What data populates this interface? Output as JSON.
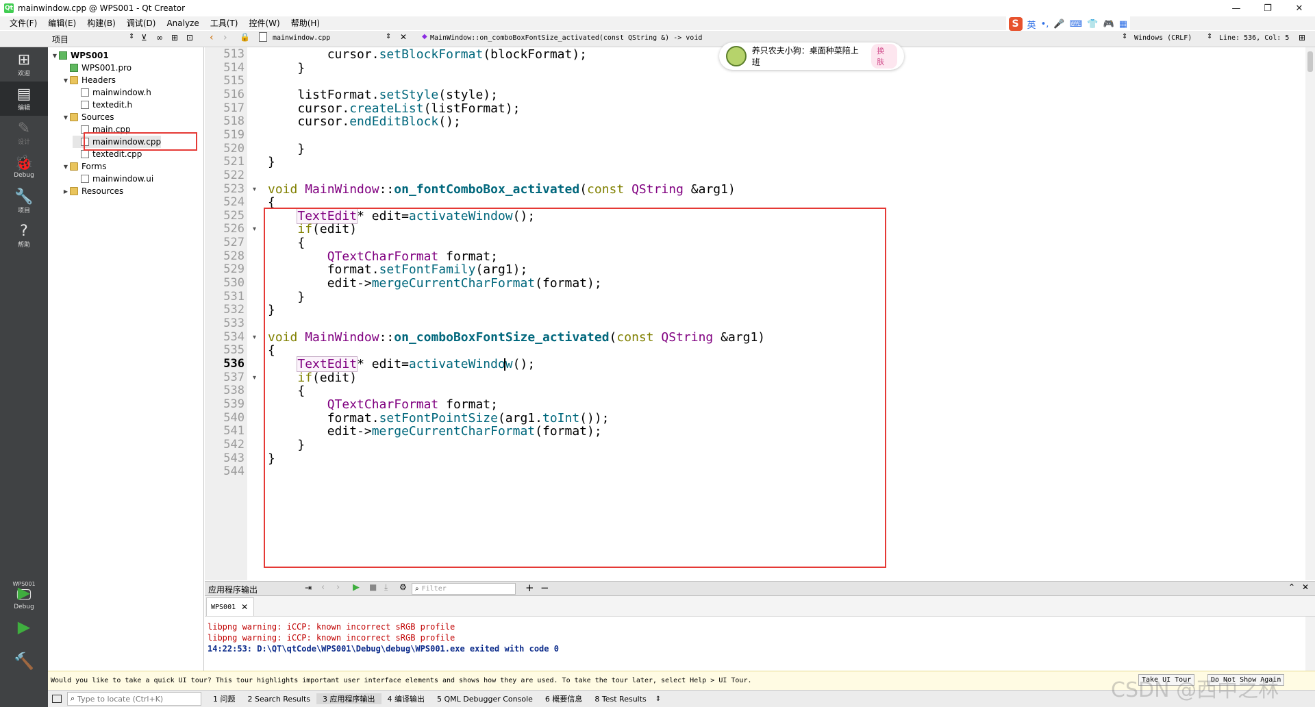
{
  "window": {
    "title": "mainwindow.cpp @ WPS001 - Qt Creator",
    "app_icon_text": "Qt",
    "minimize_icon": "—",
    "maximize_icon": "❐",
    "close_icon": "✕"
  },
  "menu": [
    "文件(F)",
    "编辑(E)",
    "构建(B)",
    "调试(D)",
    "Analyze",
    "工具(T)",
    "控件(W)",
    "帮助(H)"
  ],
  "ime": {
    "logo": "S",
    "lang": "英",
    "punct": "•,",
    "mic": "🎤",
    "keyboard": "⌨",
    "skin": "👕",
    "game": "🎮",
    "apps": "▦"
  },
  "toolbar": {
    "project_label": "项目",
    "file_tab": "mainwindow.cpp",
    "function_crumb": "MainWindow::on_comboBoxFontSize_activated(const QString &) -> void",
    "line_ending": "Windows (CRLF)",
    "cursor_pos": "Line: 536, Col: 5"
  },
  "modes": [
    {
      "label": "欢迎",
      "icon": "⊞"
    },
    {
      "label": "编辑",
      "icon": "▤"
    },
    {
      "label": "设计",
      "icon": "✎"
    },
    {
      "label": "Debug",
      "icon": "🐞"
    },
    {
      "label": "项目",
      "icon": "🔧"
    },
    {
      "label": "帮助",
      "icon": "?"
    }
  ],
  "kit": {
    "name": "WPS001",
    "mode": "Debug",
    "run_icon": "▶",
    "debug_run_icon": "▶",
    "build_icon": "🔨"
  },
  "tree": [
    {
      "label": "WPS001",
      "arrow": "▼",
      "kind": "pro",
      "indent": 0,
      "bold": true
    },
    {
      "label": "WPS001.pro",
      "arrow": "",
      "kind": "pro",
      "indent": 1
    },
    {
      "label": "Headers",
      "arrow": "▼",
      "kind": "folder",
      "indent": 1
    },
    {
      "label": "mainwindow.h",
      "arrow": "",
      "kind": "file",
      "indent": 2
    },
    {
      "label": "textedit.h",
      "arrow": "",
      "kind": "file",
      "indent": 2
    },
    {
      "label": "Sources",
      "arrow": "▼",
      "kind": "folder",
      "indent": 1
    },
    {
      "label": "main.cpp",
      "arrow": "",
      "kind": "file",
      "indent": 2
    },
    {
      "label": "mainwindow.cpp",
      "arrow": "",
      "kind": "file",
      "indent": 2
    },
    {
      "label": "textedit.cpp",
      "arrow": "",
      "kind": "file",
      "indent": 2
    },
    {
      "label": "Forms",
      "arrow": "▼",
      "kind": "folder",
      "indent": 1
    },
    {
      "label": "mainwindow.ui",
      "arrow": "",
      "kind": "file",
      "indent": 2
    },
    {
      "label": "Resources",
      "arrow": "▶",
      "kind": "folder",
      "indent": 1
    }
  ],
  "code": {
    "first_line": 513,
    "current_line": 536,
    "fold_lines": [
      523,
      526,
      534,
      537
    ],
    "lines": [
      [
        [
          "        cursor.",
          "v"
        ],
        [
          "setBlockFormat",
          "f"
        ],
        [
          "(blockFormat);",
          "v"
        ]
      ],
      [
        [
          "    }",
          "v"
        ]
      ],
      [
        [
          "",
          "v"
        ]
      ],
      [
        [
          "    listFormat.",
          "v"
        ],
        [
          "setStyle",
          "f"
        ],
        [
          "(style);",
          "v"
        ]
      ],
      [
        [
          "    cursor.",
          "v"
        ],
        [
          "createList",
          "f"
        ],
        [
          "(listFormat);",
          "v"
        ]
      ],
      [
        [
          "    cursor.",
          "v"
        ],
        [
          "endEditBlock",
          "f"
        ],
        [
          "();",
          "v"
        ]
      ],
      [
        [
          "",
          "v"
        ]
      ],
      [
        [
          "    }",
          "v"
        ]
      ],
      [
        [
          "}",
          "v"
        ]
      ],
      [
        [
          "",
          "v"
        ]
      ],
      [
        [
          "void",
          "k"
        ],
        [
          " MainWindow",
          "t"
        ],
        [
          "::",
          "v"
        ],
        [
          "on_fontComboBox_activated",
          "fb"
        ],
        [
          "(",
          "v"
        ],
        [
          "const",
          "k"
        ],
        [
          " QString",
          "t"
        ],
        [
          " &arg1)",
          "v"
        ]
      ],
      [
        [
          "{",
          "v"
        ]
      ],
      [
        [
          "    ",
          "v"
        ],
        [
          "TextEdit",
          "t hl"
        ],
        [
          "* edit=",
          "v"
        ],
        [
          "activateWindow",
          "f"
        ],
        [
          "();",
          "v"
        ]
      ],
      [
        [
          "    ",
          "v"
        ],
        [
          "if",
          "k"
        ],
        [
          "(edit)",
          "v"
        ]
      ],
      [
        [
          "    {",
          "v"
        ]
      ],
      [
        [
          "        ",
          "v"
        ],
        [
          "QTextCharFormat",
          "t"
        ],
        [
          " format;",
          "v"
        ]
      ],
      [
        [
          "        format.",
          "v"
        ],
        [
          "setFontFamily",
          "f"
        ],
        [
          "(arg1);",
          "v"
        ]
      ],
      [
        [
          "        edit->",
          "v"
        ],
        [
          "mergeCurrentCharFormat",
          "f"
        ],
        [
          "(format);",
          "v"
        ]
      ],
      [
        [
          "    }",
          "v"
        ]
      ],
      [
        [
          "}",
          "v"
        ]
      ],
      [
        [
          "",
          "v"
        ]
      ],
      [
        [
          "void",
          "k"
        ],
        [
          " MainWindow",
          "t"
        ],
        [
          "::",
          "v"
        ],
        [
          "on_comboBoxFontSize_activated",
          "fb"
        ],
        [
          "(",
          "v"
        ],
        [
          "const",
          "k"
        ],
        [
          " QString",
          "t"
        ],
        [
          " &arg1)",
          "v"
        ]
      ],
      [
        [
          "{",
          "v"
        ]
      ],
      [
        [
          "    ",
          "v"
        ],
        [
          "TextEdit",
          "t hl"
        ],
        [
          "* edit=",
          "v"
        ],
        [
          "activateWindow",
          "f"
        ],
        [
          "();",
          "v"
        ]
      ],
      [
        [
          "    ",
          "v"
        ],
        [
          "if",
          "k"
        ],
        [
          "(edit)",
          "v"
        ]
      ],
      [
        [
          "    {",
          "v"
        ]
      ],
      [
        [
          "        ",
          "v"
        ],
        [
          "QTextCharFormat",
          "t"
        ],
        [
          " format;",
          "v"
        ]
      ],
      [
        [
          "        format.",
          "v"
        ],
        [
          "setFontPointSize",
          "f"
        ],
        [
          "(arg1.",
          "v"
        ],
        [
          "toInt",
          "f"
        ],
        [
          "());",
          "v"
        ]
      ],
      [
        [
          "        edit->",
          "v"
        ],
        [
          "mergeCurrentCharFormat",
          "f"
        ],
        [
          "(format);",
          "v"
        ]
      ],
      [
        [
          "    }",
          "v"
        ]
      ],
      [
        [
          "}",
          "v"
        ]
      ],
      [
        [
          "",
          "v"
        ]
      ]
    ]
  },
  "popup": {
    "text": "养只农夫小狗：桌面种菜陪上班",
    "button": "换肤"
  },
  "output": {
    "pane_title": "应用程序输出",
    "filter_placeholder": "Filter",
    "tab_label": "WPS001",
    "lines": [
      {
        "text": "libpng warning: iCCP: known incorrect sRGB profile",
        "color": "#c00000"
      },
      {
        "text": "libpng warning: iCCP: known incorrect sRGB profile",
        "color": "#c00000"
      },
      {
        "text": "14:22:53: D:\\QT\\qtCode\\WPS001\\Debug\\debug\\WPS001.exe exited with code 0",
        "color": "#0a2a8a"
      }
    ]
  },
  "tour": {
    "text": "Would you like to take a quick UI tour? This tour highlights important user interface elements and shows how they are used. To take the tour later, select Help > UI Tour.",
    "take_btn": "Take UI Tour",
    "dismiss_btn": "Do Not Show Again"
  },
  "status": {
    "locate_placeholder": "Type to locate (Ctrl+K)",
    "panes": [
      "1 问题",
      "2 Search Results",
      "3 应用程序输出",
      "4 编译输出",
      "5 QML Debugger Console",
      "6 概要信息",
      "8 Test Results"
    ]
  },
  "watermark": "CSDN @西中之林"
}
